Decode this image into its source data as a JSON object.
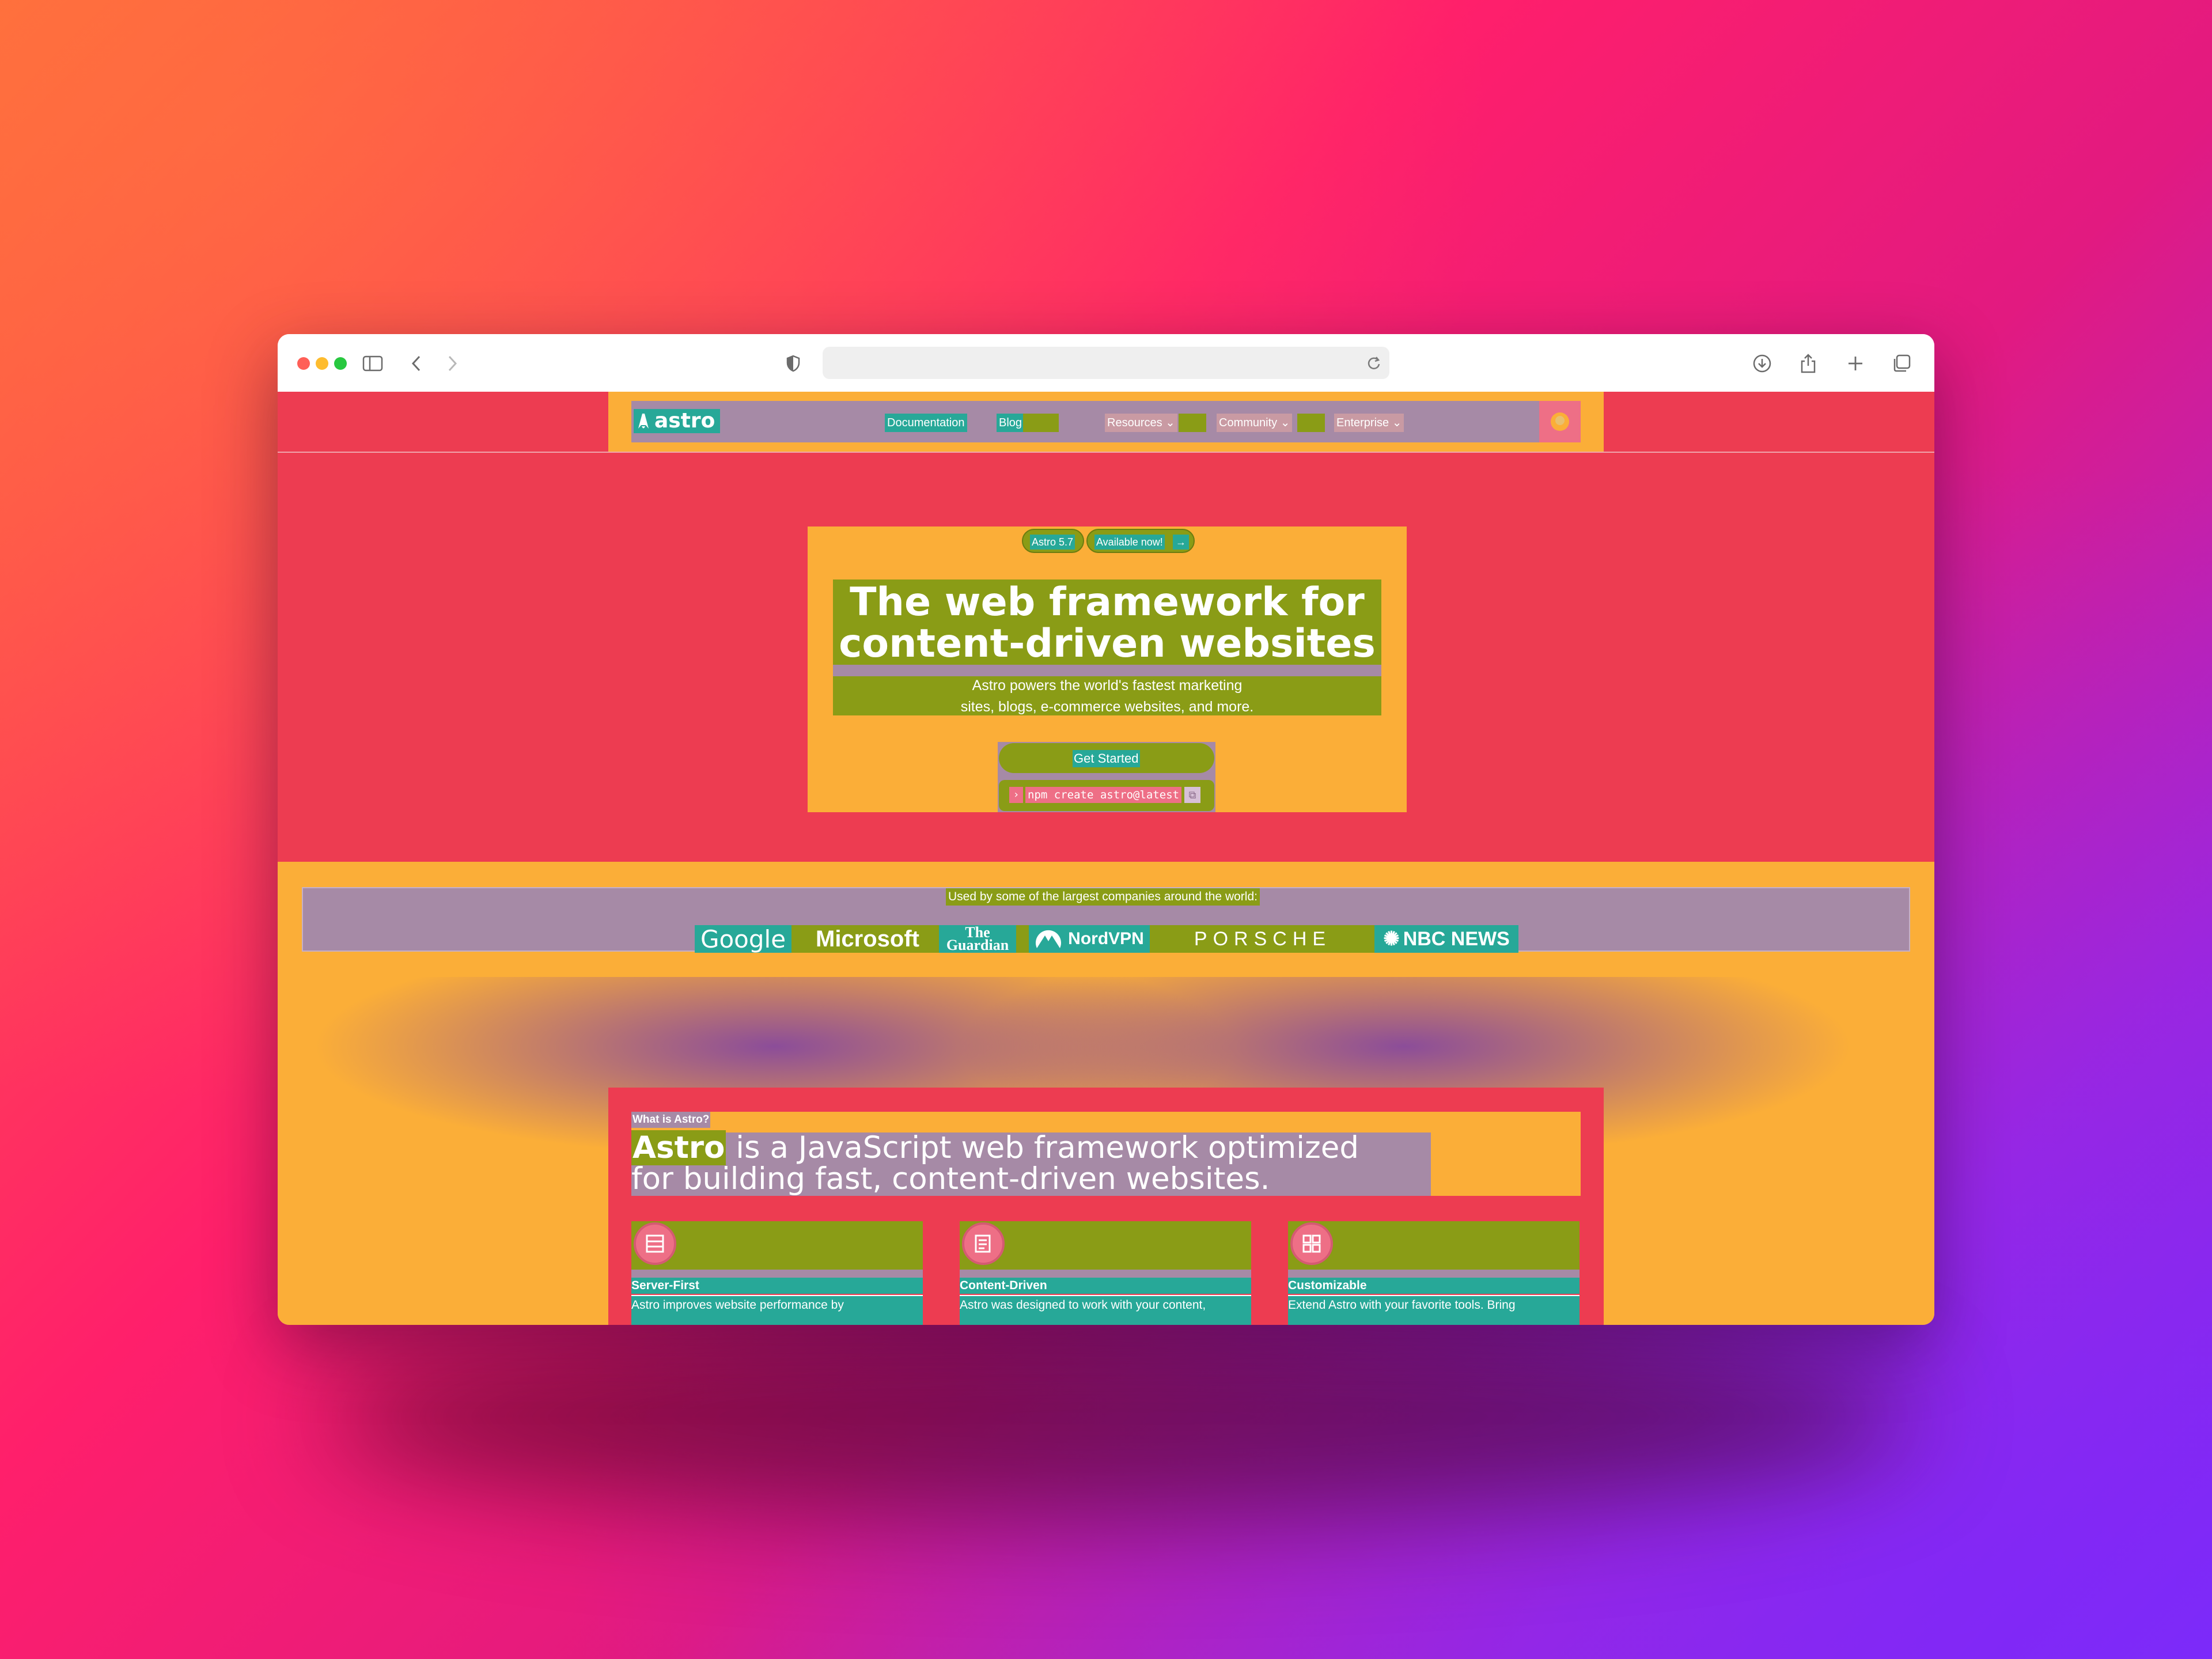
{
  "nav": {
    "logo": "astro",
    "links": [
      "Documentation",
      "Blog",
      "Resources",
      "Community",
      "Enterprise"
    ]
  },
  "hero": {
    "version_badge": "Astro 5.7",
    "available_badge": "Available now!",
    "headline_line1": "The web framework for",
    "headline_line2": "content-driven websites",
    "sub_line1": "Astro powers the world's fastest marketing",
    "sub_line2": "sites, blogs, e-commerce websites, and more.",
    "cta_label": "Get Started",
    "command": "npm create astro@latest"
  },
  "logos": {
    "heading": "Used by some of the largest companies around the world:",
    "companies": [
      "Google",
      "Microsoft",
      "The Guardian",
      "NordVPN",
      "PORSCHE",
      "NBC NEWS"
    ]
  },
  "what": {
    "label": "What is Astro?",
    "highlight": "Astro",
    "line1_rest": " is a JavaScript web framework optimized",
    "line2": "for building fast, content-driven websites."
  },
  "features": [
    {
      "title": "Server-First",
      "text": "Astro improves website performance by",
      "icon": "server-icon"
    },
    {
      "title": "Content-Driven",
      "text": "Astro was designed to work with your content,",
      "icon": "content-icon"
    },
    {
      "title": "Customizable",
      "text": "Extend Astro with your favorite tools. Bring",
      "icon": "customize-icon"
    }
  ]
}
